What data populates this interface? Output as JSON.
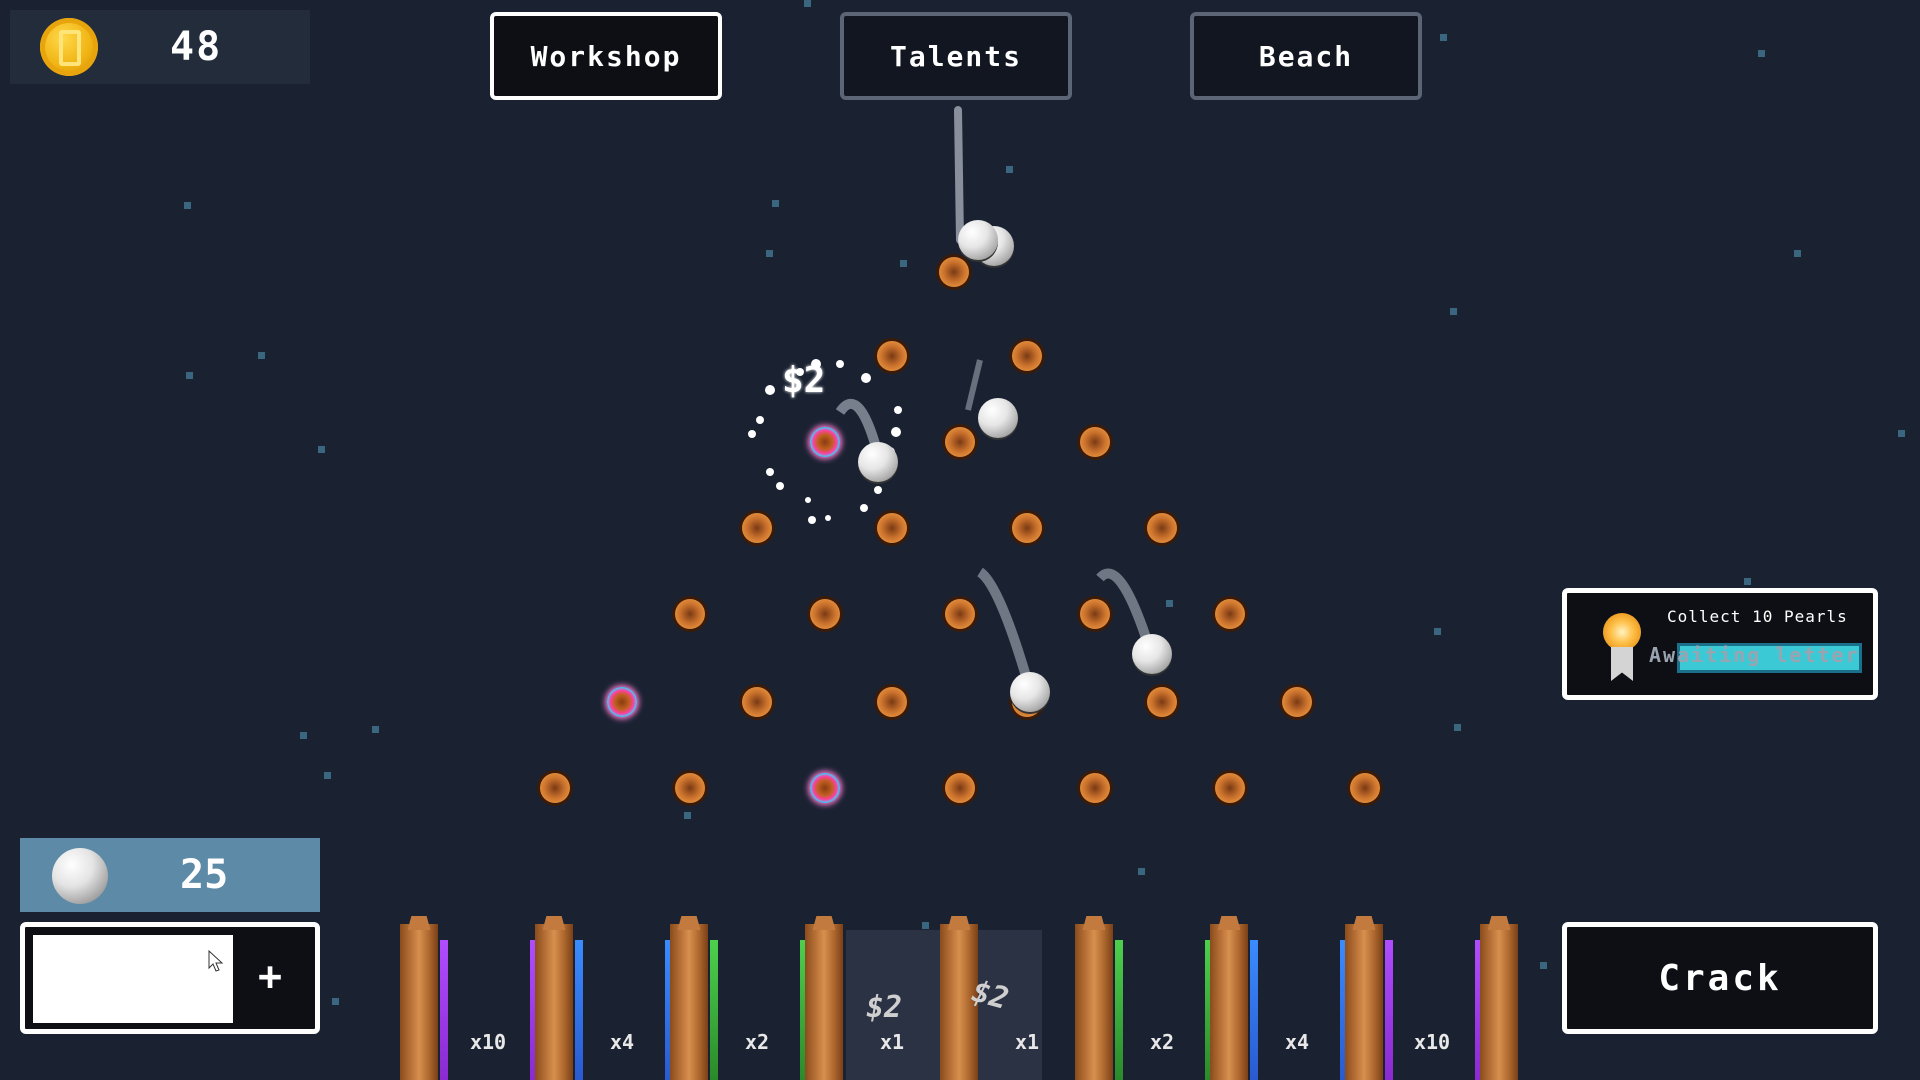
{
  "header": {
    "coins": "48",
    "nav": [
      {
        "label": "Workshop",
        "active": true
      },
      {
        "label": "Talents",
        "active": false
      },
      {
        "label": "Beach",
        "active": false
      }
    ]
  },
  "quest": {
    "title": "Collect 10 Pearls",
    "status": "Awaiting letter"
  },
  "balls": {
    "count": "25",
    "add_button": "+"
  },
  "crack_button": "Crack",
  "popups": {
    "peg_reward": "$2",
    "bin_reward_1": "$2",
    "bin_reward_2": "$2"
  },
  "multipliers": [
    "x10",
    "x4",
    "x2",
    "x1",
    "x1",
    "x2",
    "x4",
    "x10"
  ],
  "colors": {
    "background": "#1a2232",
    "peg": "#c8702c",
    "quest_bar": "#3bc9d6",
    "balls_panel": "#5d8aa6"
  }
}
